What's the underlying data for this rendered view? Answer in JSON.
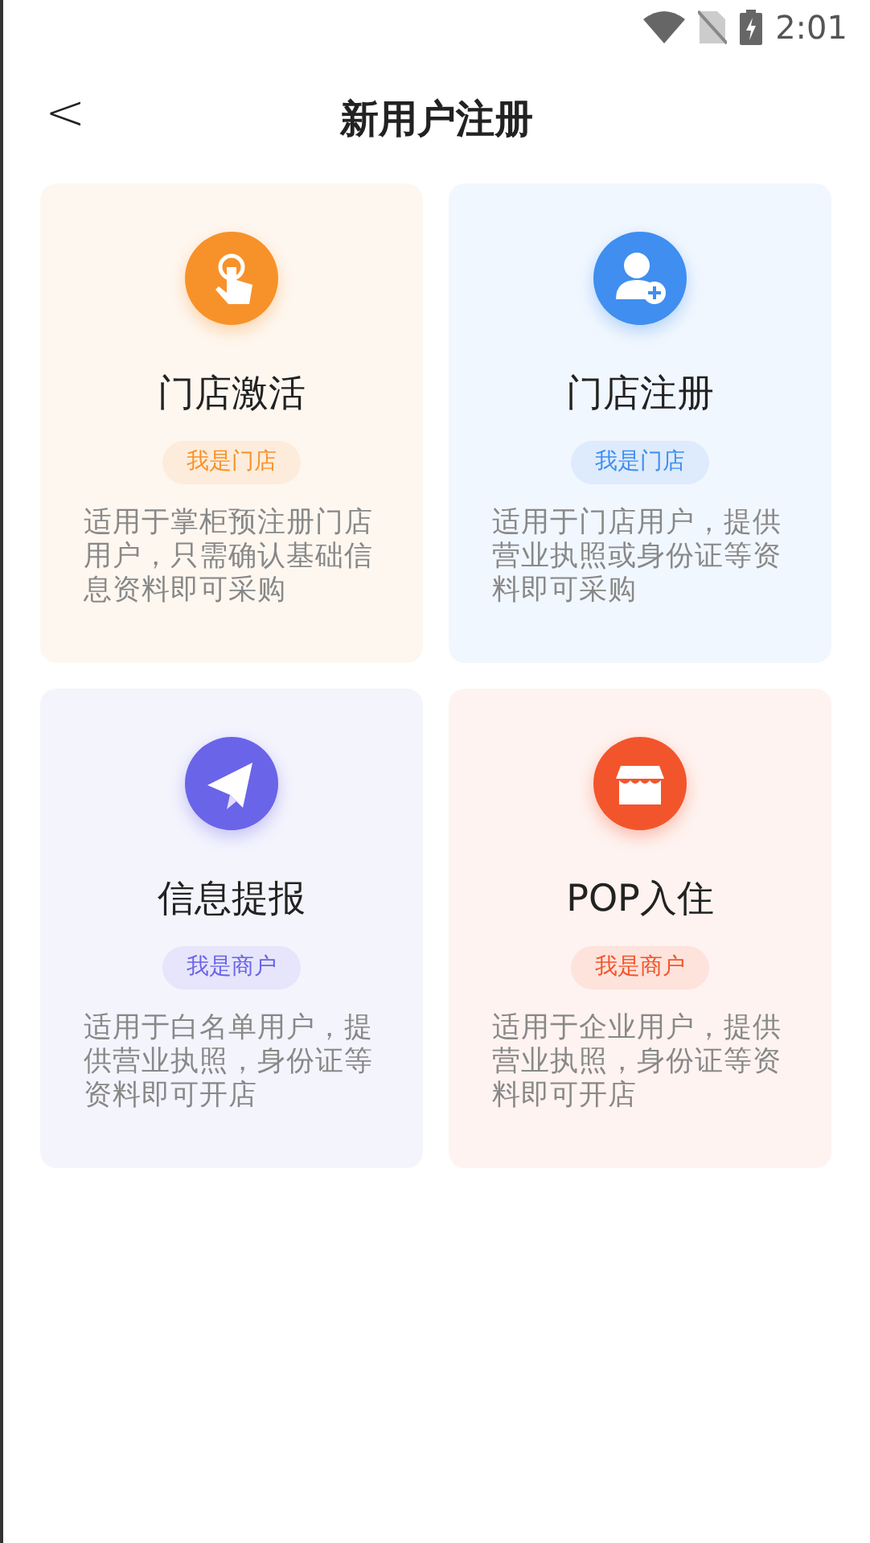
{
  "status_bar": {
    "time": "2:01"
  },
  "header": {
    "back": "<",
    "title": "新用户注册"
  },
  "cards": [
    {
      "kind": "tap",
      "color": "#f7922a",
      "title": "门店激活",
      "tag": "我是门店",
      "description": "适用于掌柜预注册门店用户，只需确认基础信息资料即可采购"
    },
    {
      "kind": "user-add",
      "color": "#3f8ef0",
      "title": "门店注册",
      "tag": "我是门店",
      "description": "适用于门店用户，提供营业执照或身份证等资料即可采购"
    },
    {
      "kind": "plane",
      "color": "#6a64e8",
      "title": "信息提报",
      "tag": "我是商户",
      "description": "适用于白名单用户，提供营业执照，身份证等资料即可开店"
    },
    {
      "kind": "store",
      "color": "#f2552c",
      "title": "POP入住",
      "tag": "我是商户",
      "description": "适用于企业用户，提供营业执照，身份证等资料即可开店"
    }
  ]
}
